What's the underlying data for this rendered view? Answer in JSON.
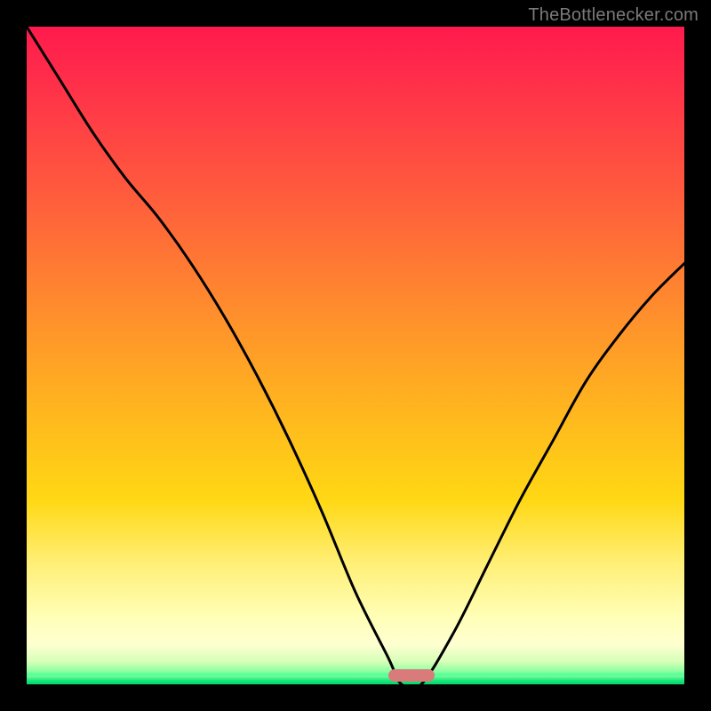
{
  "watermark": "TheBottlenecker.com",
  "chart_data": {
    "type": "line",
    "title": "",
    "xlabel": "",
    "ylabel": "",
    "xlim": [
      0,
      100
    ],
    "ylim": [
      0,
      100
    ],
    "x": [
      0,
      5,
      10,
      15,
      20,
      25,
      30,
      35,
      40,
      45,
      50,
      55,
      57,
      60,
      65,
      70,
      75,
      80,
      85,
      90,
      95,
      100
    ],
    "values": [
      100,
      92,
      84,
      77,
      71,
      64,
      56,
      47,
      37,
      26,
      14,
      4,
      0,
      0,
      8,
      18,
      28,
      37,
      46,
      53,
      59,
      64
    ],
    "trough_x_range": [
      55,
      62
    ],
    "trough_marker_color": "#d97b7b",
    "gradient_stops": [
      {
        "pos": 0,
        "color": "#ff1a4d"
      },
      {
        "pos": 0.45,
        "color": "#ff9a2a"
      },
      {
        "pos": 0.75,
        "color": "#ffe040"
      },
      {
        "pos": 0.93,
        "color": "#ffffc0"
      },
      {
        "pos": 1.0,
        "color": "#00e676"
      }
    ]
  },
  "colors": {
    "curve": "#000000",
    "background": "#000000",
    "watermark": "#7a7a7a"
  }
}
